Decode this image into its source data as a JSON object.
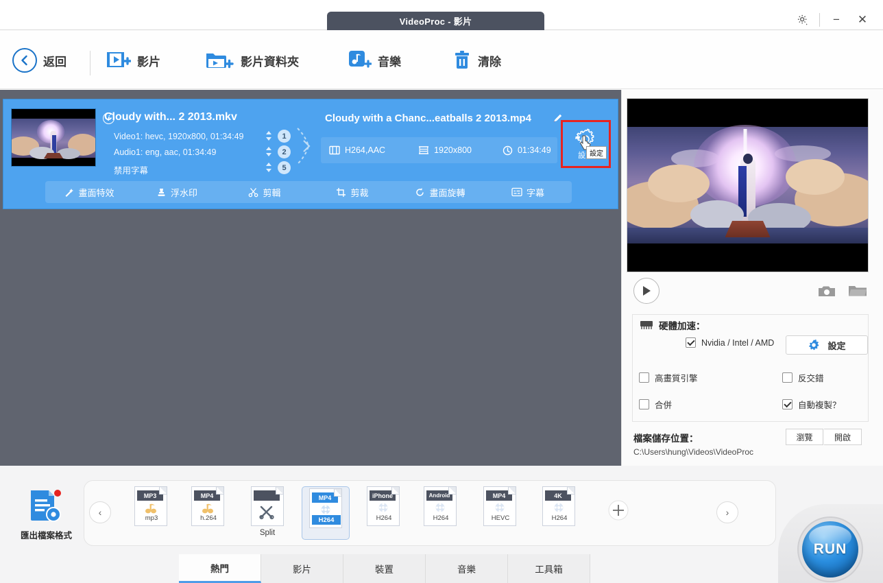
{
  "window": {
    "title": "VideoProc - 影片",
    "gear_icon": "gear-dropdown-icon",
    "minimize": "−",
    "close": "✕"
  },
  "toolbar": {
    "back": "返回",
    "add_video": "影片",
    "add_video_folder": "影片資料夾",
    "add_music": "音樂",
    "clear": "清除"
  },
  "file_card": {
    "source_title": "Cloudy with... 2 2013.mkv",
    "info_icon": "i",
    "streams": [
      {
        "text": "Video1: hevc, 1920x800, 01:34:49",
        "index": "1"
      },
      {
        "text": "Audio1: eng, aac, 01:34:49",
        "index": "2"
      },
      {
        "text": "禁用字幕",
        "index": "5"
      }
    ],
    "output_title": "Cloudy with a Chanc...eatballs 2 2013.mp4",
    "output_codec": "H264,AAC",
    "output_resolution": "1920x800",
    "output_duration": "01:34:49",
    "settings_label": "設定",
    "settings_tooltip": "設定",
    "close_icon": "✕",
    "edit_tools": [
      {
        "label": "畫面特效",
        "icon": "magic-wand-icon"
      },
      {
        "label": "浮水印",
        "icon": "stamp-icon"
      },
      {
        "label": "剪輯",
        "icon": "scissors-icon"
      },
      {
        "label": "剪裁",
        "icon": "crop-icon"
      },
      {
        "label": "畫面旋轉",
        "icon": "rotate-icon"
      },
      {
        "label": "字幕",
        "icon": "subtitle-icon"
      }
    ]
  },
  "preview": {
    "play_icon": "play-icon",
    "snapshot_icon": "camera-icon",
    "open_folder_icon": "folder-icon"
  },
  "options": {
    "hw_accel_title": "硬體加速：",
    "hw_vendors_label": "Nvidia / Intel / AMD",
    "hw_vendors_checked": true,
    "hw_settings_button": "設定",
    "deinterlace_label": "高畫質引擎",
    "deinterlace_checked": false,
    "antiinterlace_label": "反交錯",
    "antiinterlace_checked": false,
    "merge_label": "合併",
    "merge_checked": false,
    "autocopy_label": "自動複製？",
    "autocopy_checked": true,
    "save_location_title": "檔案儲存位置：",
    "save_location_path": "C:\\Users\\hung\\Videos\\VideoProc",
    "browse_button": "瀏覽",
    "open_button": "開啟"
  },
  "presets": {
    "export_label": "匯出檔案格式",
    "nav_prev": "‹",
    "nav_next": "›",
    "add_icon": "plus-icon",
    "items": [
      {
        "tag": "MP3",
        "mid": "music-icon",
        "bottom": "mp3",
        "selected": false
      },
      {
        "tag": "MP4",
        "mid": "music-icon",
        "bottom": "h.264",
        "selected": false
      },
      {
        "tag": "",
        "mid": "tools-icon",
        "bottom": "",
        "label": "Split",
        "selected": false
      },
      {
        "tag": "MP4",
        "mid": "film-reel-icon",
        "bottom": "H264",
        "selected": true
      },
      {
        "tag": "iPhone",
        "mid": "film-reel-icon",
        "bottom": "H264",
        "selected": false
      },
      {
        "tag": "Android",
        "mid": "film-reel-icon",
        "bottom": "H264",
        "selected": false
      },
      {
        "tag": "MP4",
        "mid": "film-reel-icon",
        "bottom": "HEVC",
        "selected": false
      },
      {
        "tag": "4K",
        "mid": "film-reel-icon",
        "bottom": "H264",
        "selected": false
      }
    ]
  },
  "tabs": [
    {
      "label": "熱門",
      "active": true
    },
    {
      "label": "影片",
      "active": false
    },
    {
      "label": "裝置",
      "active": false
    },
    {
      "label": "音樂",
      "active": false
    },
    {
      "label": "工具箱",
      "active": false
    }
  ],
  "run": {
    "label": "RUN"
  },
  "colors": {
    "accent_blue": "#4ea3ef",
    "toolbar_blue": "#2f8bdf",
    "dark_bg": "#60646f",
    "annotation_red": "#e8231f"
  }
}
